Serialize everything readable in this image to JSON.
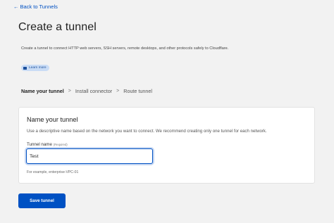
{
  "back_link": {
    "arrow": "←",
    "label": "Back to Tunnels"
  },
  "page": {
    "title": "Create a tunnel",
    "description": "Create a tunnel to connect HTTP web servers, SSH servers, remote desktops, and other protocols safely to Cloudflare.",
    "learn_more_label": "Learn more",
    "learn_more_icon": "book-icon"
  },
  "steps": [
    {
      "label": "Name your tunnel",
      "active": true
    },
    {
      "label": "Install connector",
      "active": false
    },
    {
      "label": "Route tunnel",
      "active": false
    }
  ],
  "step_separator": ">",
  "card": {
    "title": "Name your tunnel",
    "description": "Use a descriptive name based on the network you want to connect. We recommend creating only one tunnel for each network.",
    "field_label": "Tunnel name",
    "field_required": "(Required)",
    "field_value": "Test",
    "hint": "For example, enterprise-VPC-01"
  },
  "save_button": {
    "label": "Save tunnel"
  },
  "colors": {
    "accent": "#0051c3",
    "background": "#f2f2f2",
    "pill": "#c9dcf5"
  }
}
